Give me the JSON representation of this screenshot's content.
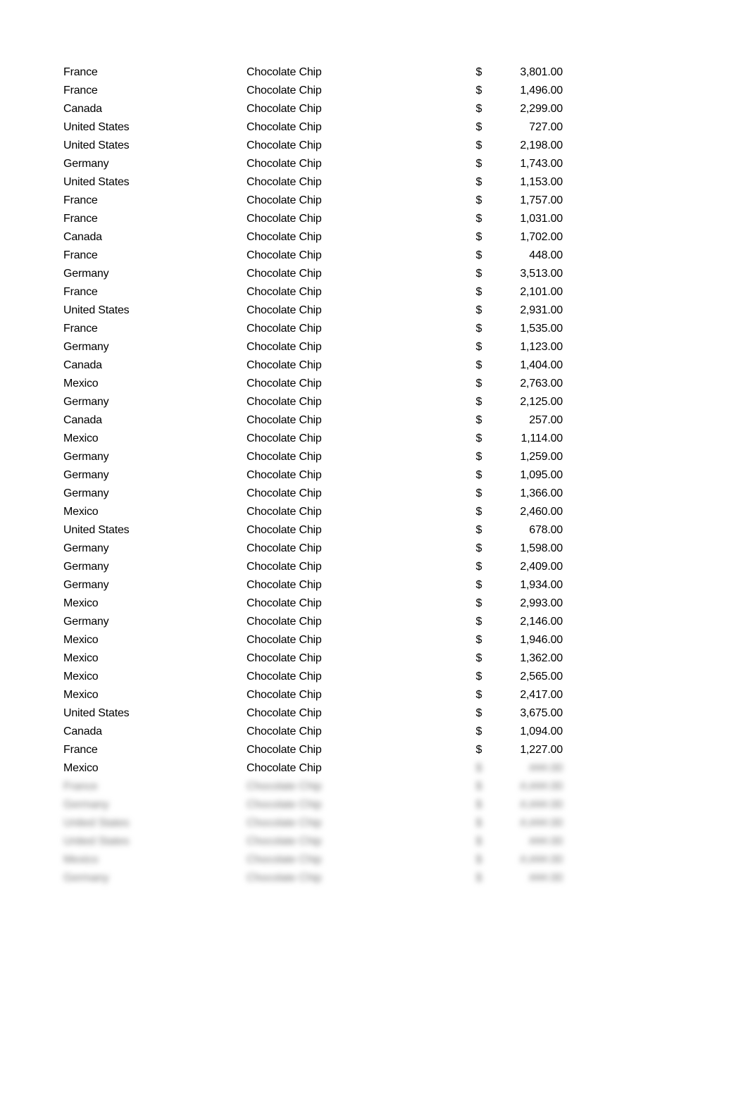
{
  "table": {
    "rows": [
      {
        "country": "France",
        "product": "Chocolate Chip",
        "currency": "$",
        "amount": "3,801.00"
      },
      {
        "country": "France",
        "product": "Chocolate Chip",
        "currency": "$",
        "amount": "1,496.00"
      },
      {
        "country": "Canada",
        "product": "Chocolate Chip",
        "currency": "$",
        "amount": "2,299.00"
      },
      {
        "country": "United States",
        "product": "Chocolate Chip",
        "currency": "$",
        "amount": "727.00"
      },
      {
        "country": "United States",
        "product": "Chocolate Chip",
        "currency": "$",
        "amount": "2,198.00"
      },
      {
        "country": "Germany",
        "product": "Chocolate Chip",
        "currency": "$",
        "amount": "1,743.00"
      },
      {
        "country": "United States",
        "product": "Chocolate Chip",
        "currency": "$",
        "amount": "1,153.00"
      },
      {
        "country": "France",
        "product": "Chocolate Chip",
        "currency": "$",
        "amount": "1,757.00"
      },
      {
        "country": "France",
        "product": "Chocolate Chip",
        "currency": "$",
        "amount": "1,031.00"
      },
      {
        "country": "Canada",
        "product": "Chocolate Chip",
        "currency": "$",
        "amount": "1,702.00"
      },
      {
        "country": "France",
        "product": "Chocolate Chip",
        "currency": "$",
        "amount": "448.00"
      },
      {
        "country": "Germany",
        "product": "Chocolate Chip",
        "currency": "$",
        "amount": "3,513.00"
      },
      {
        "country": "France",
        "product": "Chocolate Chip",
        "currency": "$",
        "amount": "2,101.00"
      },
      {
        "country": "United States",
        "product": "Chocolate Chip",
        "currency": "$",
        "amount": "2,931.00"
      },
      {
        "country": "France",
        "product": "Chocolate Chip",
        "currency": "$",
        "amount": "1,535.00"
      },
      {
        "country": "Germany",
        "product": "Chocolate Chip",
        "currency": "$",
        "amount": "1,123.00"
      },
      {
        "country": "Canada",
        "product": "Chocolate Chip",
        "currency": "$",
        "amount": "1,404.00"
      },
      {
        "country": "Mexico",
        "product": "Chocolate Chip",
        "currency": "$",
        "amount": "2,763.00"
      },
      {
        "country": "Germany",
        "product": "Chocolate Chip",
        "currency": "$",
        "amount": "2,125.00"
      },
      {
        "country": "Canada",
        "product": "Chocolate Chip",
        "currency": "$",
        "amount": "257.00"
      },
      {
        "country": "Mexico",
        "product": "Chocolate Chip",
        "currency": "$",
        "amount": "1,114.00"
      },
      {
        "country": "Germany",
        "product": "Chocolate Chip",
        "currency": "$",
        "amount": "1,259.00"
      },
      {
        "country": "Germany",
        "product": "Chocolate Chip",
        "currency": "$",
        "amount": "1,095.00"
      },
      {
        "country": "Germany",
        "product": "Chocolate Chip",
        "currency": "$",
        "amount": "1,366.00"
      },
      {
        "country": "Mexico",
        "product": "Chocolate Chip",
        "currency": "$",
        "amount": "2,460.00"
      },
      {
        "country": "United States",
        "product": "Chocolate Chip",
        "currency": "$",
        "amount": "678.00"
      },
      {
        "country": "Germany",
        "product": "Chocolate Chip",
        "currency": "$",
        "amount": "1,598.00"
      },
      {
        "country": "Germany",
        "product": "Chocolate Chip",
        "currency": "$",
        "amount": "2,409.00"
      },
      {
        "country": "Germany",
        "product": "Chocolate Chip",
        "currency": "$",
        "amount": "1,934.00"
      },
      {
        "country": "Mexico",
        "product": "Chocolate Chip",
        "currency": "$",
        "amount": "2,993.00"
      },
      {
        "country": "Germany",
        "product": "Chocolate Chip",
        "currency": "$",
        "amount": "2,146.00"
      },
      {
        "country": "Mexico",
        "product": "Chocolate Chip",
        "currency": "$",
        "amount": "1,946.00"
      },
      {
        "country": "Mexico",
        "product": "Chocolate Chip",
        "currency": "$",
        "amount": "1,362.00"
      },
      {
        "country": "Mexico",
        "product": "Chocolate Chip",
        "currency": "$",
        "amount": "2,565.00"
      },
      {
        "country": "Mexico",
        "product": "Chocolate Chip",
        "currency": "$",
        "amount": "2,417.00"
      },
      {
        "country": "United States",
        "product": "Chocolate Chip",
        "currency": "$",
        "amount": "3,675.00"
      },
      {
        "country": "Canada",
        "product": "Chocolate Chip",
        "currency": "$",
        "amount": "1,094.00"
      },
      {
        "country": "France",
        "product": "Chocolate Chip",
        "currency": "$",
        "amount": "1,227.00"
      }
    ],
    "partial_row": {
      "country": "Mexico",
      "product": "Chocolate Chip",
      "currency": "$",
      "amount": "###.00"
    },
    "blurred_rows": [
      {
        "country": "France",
        "product": "Chocolate Chip",
        "currency": "$",
        "amount": "#,###.00"
      },
      {
        "country": "Germany",
        "product": "Chocolate Chip",
        "currency": "$",
        "amount": "#,###.00"
      },
      {
        "country": "United States",
        "product": "Chocolate Chip",
        "currency": "$",
        "amount": "#,###.00"
      },
      {
        "country": "United States",
        "product": "Chocolate Chip",
        "currency": "$",
        "amount": "###.00"
      },
      {
        "country": "Mexico",
        "product": "Chocolate Chip",
        "currency": "$",
        "amount": "#,###.00"
      },
      {
        "country": "Germany",
        "product": "Chocolate Chip",
        "currency": "$",
        "amount": "###.00"
      }
    ]
  }
}
